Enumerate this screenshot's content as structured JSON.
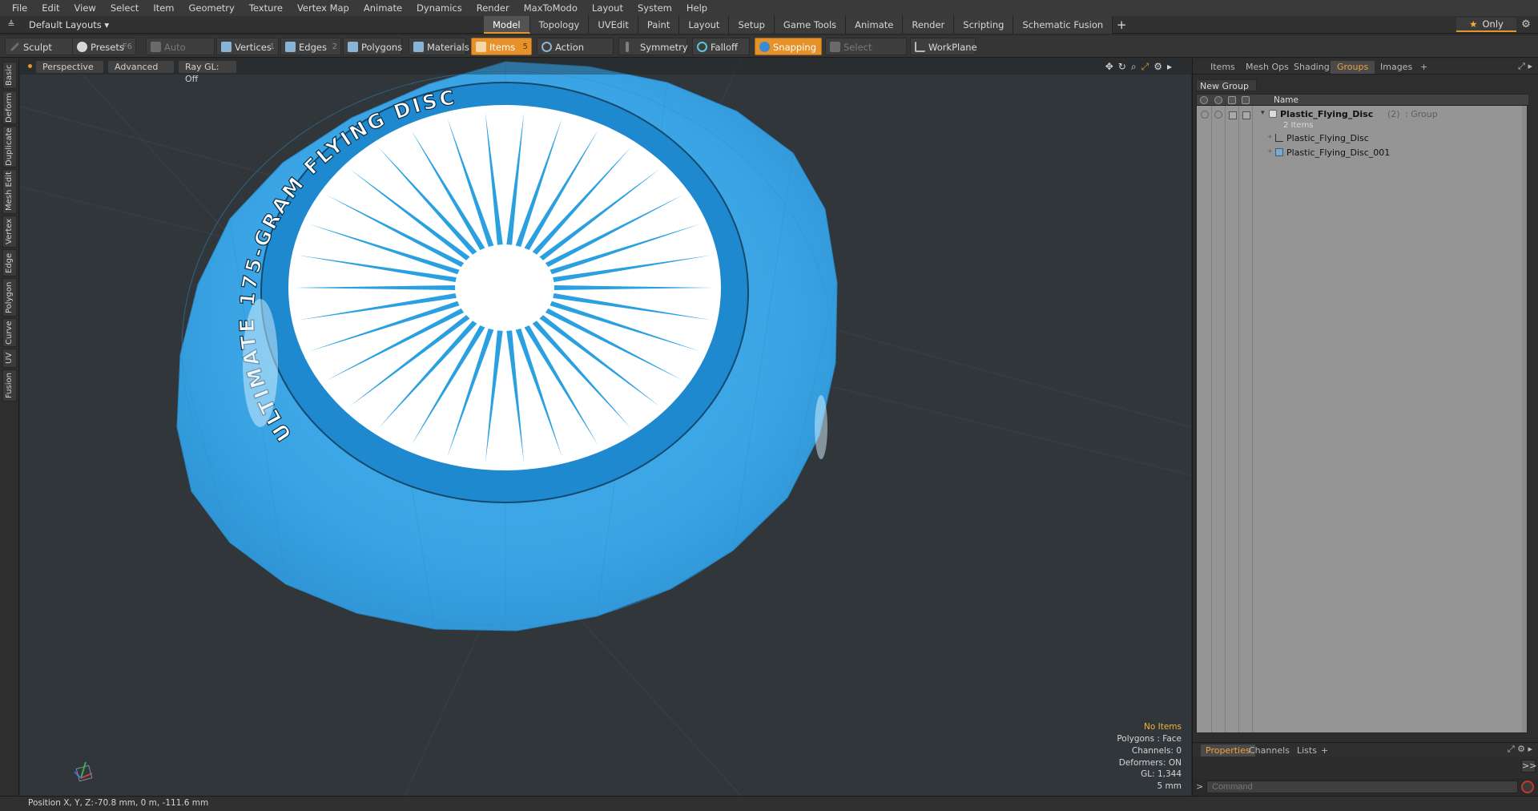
{
  "menu": [
    "File",
    "Edit",
    "View",
    "Select",
    "Item",
    "Geometry",
    "Texture",
    "Vertex Map",
    "Animate",
    "Dynamics",
    "Render",
    "MaxToModo",
    "Layout",
    "System",
    "Help"
  ],
  "layout_bar": {
    "layouts_label": "Default Layouts ▾",
    "tabs": [
      "Model",
      "Topology",
      "UVEdit",
      "Paint",
      "Layout",
      "Setup",
      "Game Tools",
      "Animate",
      "Render",
      "Scripting",
      "Schematic Fusion"
    ],
    "active_tab": "Model",
    "add_tab": "+",
    "only_label": "Only",
    "only_icon": "star-icon"
  },
  "toolbar": {
    "sculpt": "Sculpt",
    "presets": "Presets",
    "presets_key": "F6",
    "auto_select": "Auto Select",
    "vertices": "Vertices",
    "vertices_count": "1",
    "edges": "Edges",
    "edges_count": "2",
    "polygons": "Polygons",
    "materials": "Materials",
    "items": "Items",
    "items_count": "5",
    "action_center": "Action Center",
    "symmetry": "Symmetry",
    "falloff": "Falloff",
    "snapping": "Snapping",
    "select_through": "Select Through",
    "workplane": "WorkPlane"
  },
  "left_tabs": [
    "Basic",
    "Deform",
    "Duplicate",
    "Mesh Edit",
    "Vertex",
    "Edge",
    "Polygon",
    "Curve",
    "UV",
    "Fusion"
  ],
  "viewport": {
    "view": "Perspective",
    "shading": "Advanced",
    "raygl": "Ray GL: Off",
    "disc_text": "ULTIMATE 175-GRAM FLYING DISC",
    "info": {
      "no_items": "No Items",
      "polygons": "Polygons : Face",
      "channels": "Channels: 0",
      "deformers": "Deformers: ON",
      "gl": "GL: 1,344",
      "unit": "5 mm"
    },
    "colors": {
      "disc_blue": "#3ea7e6",
      "disc_dark": "#1f89cf",
      "label_white": "#ffffff",
      "background": "#31363a"
    }
  },
  "status": {
    "position_label": "Position X, Y, Z:",
    "position_value": "-70.8 mm, 0 m, -111.6 mm"
  },
  "right_panel": {
    "tabs": [
      "Items",
      "Mesh Ops",
      "Shading",
      "Groups",
      "Images"
    ],
    "active_tab": "Groups",
    "add_tab": "+",
    "new_group": "New Group",
    "name_header": "Name",
    "group": {
      "name": "Plastic_Flying_Disc",
      "count": "(2)",
      "type": ": Group",
      "subtitle": "2 Items"
    },
    "children": [
      "Plastic_Flying_Disc",
      "Plastic_Flying_Disc_001"
    ],
    "bottom_tabs": [
      "Properties",
      "Channels",
      "Lists"
    ],
    "bottom_active": "Properties",
    "bottom_add": "+",
    "expand_label": ">>",
    "command_placeholder": "Command",
    "command_prompt": ">"
  }
}
